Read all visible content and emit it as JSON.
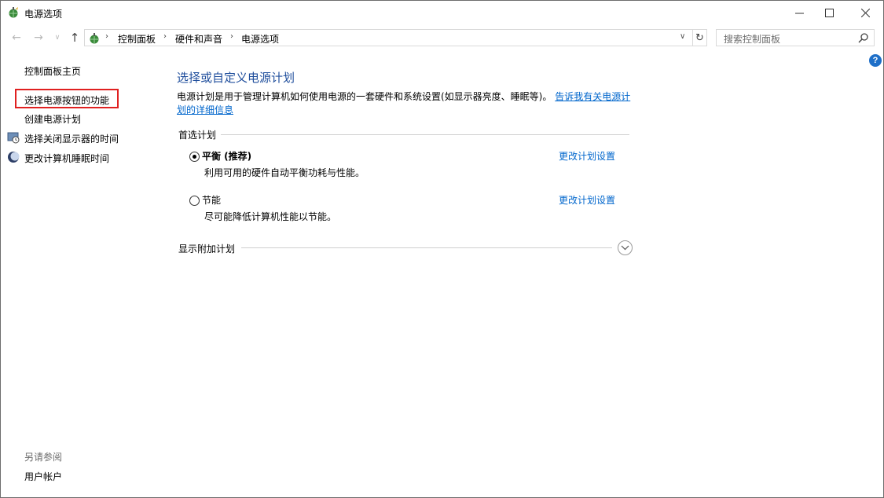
{
  "window": {
    "title": "电源选项",
    "controls": {
      "minimize": "—",
      "maximize": "☐",
      "close": "✕"
    }
  },
  "nav": {
    "back": "←",
    "forward": "→",
    "recent": "∨",
    "up": "↑",
    "breadcrumb": [
      "控制面板",
      "硬件和声音",
      "电源选项"
    ],
    "breadcrumb_sep": "›",
    "dropdown": "∨",
    "refresh": "↻",
    "search_placeholder": "搜索控制面板"
  },
  "help": "?",
  "sidebar": {
    "home": "控制面板主页",
    "items": [
      {
        "label": "选择电源按钮的功能",
        "highlighted": true
      },
      {
        "label": "创建电源计划"
      },
      {
        "label": "选择关闭显示器的时间",
        "icon": "display-clock-icon"
      },
      {
        "label": "更改计算机睡眠时间",
        "icon": "moon-icon"
      }
    ],
    "see_also": "另请参阅",
    "user_accounts": "用户帐户"
  },
  "main": {
    "title": "选择或自定义电源计划",
    "description": "电源计划是用于管理计算机如何使用电源的一套硬件和系统设置(如显示器亮度、睡眠等)。",
    "description_link": "告诉我有关电源计划的详细信息",
    "preferred_label": "首选计划",
    "plans": [
      {
        "name": "平衡 (推荐)",
        "desc": "利用可用的硬件自动平衡功耗与性能。",
        "link": "更改计划设置",
        "selected": true
      },
      {
        "name": "节能",
        "desc": "尽可能降低计算机性能以节能。",
        "link": "更改计划设置",
        "selected": false
      }
    ],
    "additional_label": "显示附加计划"
  },
  "colors": {
    "accent": "#1f4e9c",
    "link": "#0066cc",
    "highlight": "#e02020"
  }
}
